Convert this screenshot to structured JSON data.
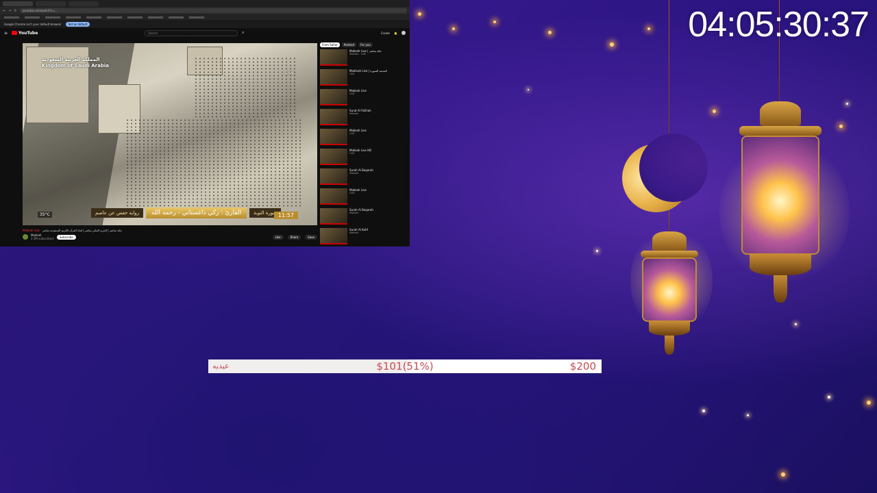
{
  "overlay": {
    "countdown": "04:05:30:37",
    "goal": {
      "label": "عيديه",
      "raised": "$101(51%)",
      "target": "$200",
      "progress_fraction": 0.51
    }
  },
  "browser": {
    "url": "youtube.com/watch?v=...",
    "infobar_text": "Google Chrome isn't your default browser",
    "infobar_button": "Set as default",
    "youtube": {
      "logo": "YouTube",
      "search_placeholder": "Search",
      "create_label": "Create"
    },
    "player": {
      "overlay_title_line1": "المملكة العربية السعودية",
      "overlay_title_line2": "Kingdom of Saudi Arabia",
      "live_label": "Live",
      "reciter": "القارئ : زكي داغستاني - رحمه الله",
      "surah": "سورة التوبة",
      "riwaya": "رواية حفص عن عاصم",
      "temperature": "35°C",
      "time": "11:57"
    },
    "video": {
      "title": "مكة مباشر | الحرم المكي مباشر | قناة القرآن الكريم السعودية مباشر",
      "live_badge": "Makkah Live",
      "channel": "Makkah",
      "subscribers": "2.3M subscribers",
      "subscribe_label": "Subscribe",
      "actions": [
        "Like",
        "Share",
        "Save"
      ]
    },
    "sidebar": {
      "chips": [
        "From Sahar",
        "Related",
        "For you"
      ],
      "items": [
        {
          "title": "Makkah Live | مكة مباشر",
          "sub": "Makkah · LIVE"
        },
        {
          "title": "Madinah Live | المدينة المنورة",
          "sub": "LIVE"
        },
        {
          "title": "Makkah Live",
          "sub": "LIVE"
        },
        {
          "title": "Surat Al Fatihah",
          "sub": "Makkah"
        },
        {
          "title": "Makkah Live",
          "sub": "LIVE"
        },
        {
          "title": "Makkah Live HD",
          "sub": "LIVE"
        },
        {
          "title": "Surah Al Baqarah",
          "sub": "Makkah"
        },
        {
          "title": "Makkah Live",
          "sub": "LIVE"
        },
        {
          "title": "Surah Al Baqarah",
          "sub": "Makkah"
        },
        {
          "title": "Surah Al Kahf",
          "sub": "Makkah"
        }
      ]
    }
  },
  "colors": {
    "goal_text": "#c84b54",
    "background": "#2a1470",
    "accent_gold": "#ffd27a"
  }
}
